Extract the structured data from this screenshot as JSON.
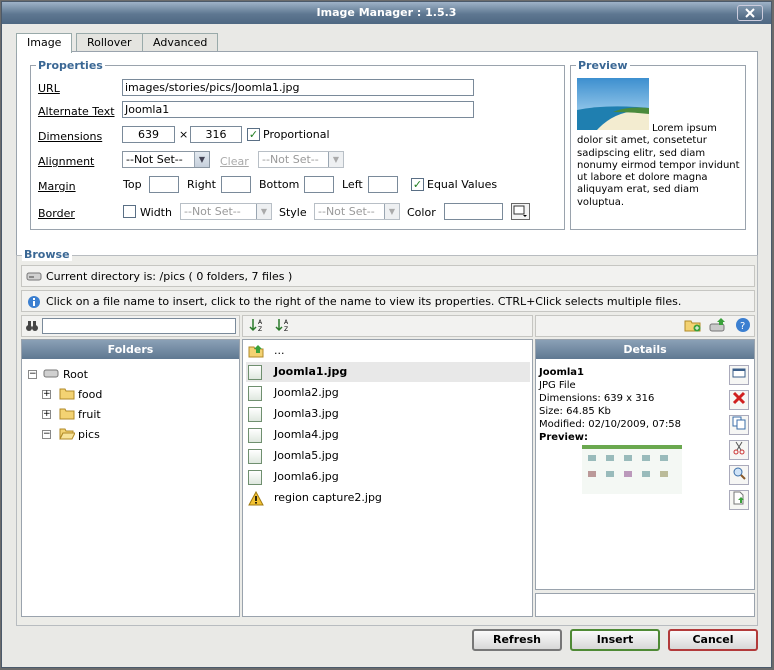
{
  "window": {
    "title": "Image Manager : 1.5.3"
  },
  "tabs": [
    "Image",
    "Rollover",
    "Advanced"
  ],
  "properties": {
    "legend": "Properties",
    "url_label": "URL",
    "url_value": "images/stories/pics/Joomla1.jpg",
    "alt_label": "Alternate Text",
    "alt_value": "Joomla1",
    "dimensions_label": "Dimensions",
    "width_value": "639",
    "times": "×",
    "height_value": "316",
    "proportional_label": "Proportional",
    "alignment_label": "Alignment",
    "alignment_value": "--Not Set--",
    "clear_label": "Clear",
    "clear_value": "--Not Set--",
    "margin_label": "Margin",
    "top_label": "Top",
    "right_label": "Right",
    "bottom_label": "Bottom",
    "left_label": "Left",
    "equal_values_label": "Equal Values",
    "border_label": "Border",
    "border_width_label": "Width",
    "border_width_value": "--Not Set--",
    "style_label": "Style",
    "style_value": "--Not Set--",
    "color_label": "Color"
  },
  "preview": {
    "legend": "Preview",
    "text": "Lorem ipsum dolor sit amet, consetetur sadipscing elitr, sed diam nonumy eirmod tempor invidunt ut labore et dolore magna aliquyam erat, sed diam voluptua."
  },
  "browse": {
    "legend": "Browse",
    "current_dir": "Current directory is: /pics ( 0 folders, 7 files )",
    "info": "Click on a file name to insert, click to the right of the name to view its properties. CTRL+Click selects multiple files.",
    "folders_header": "Folders",
    "details_header": "Details",
    "tree": {
      "root": "Root",
      "items": [
        "food",
        "fruit",
        "pics"
      ]
    },
    "up_label": "...",
    "files": [
      "Joomla1.jpg",
      "Joomla2.jpg",
      "Joomla3.jpg",
      "Joomla4.jpg",
      "Joomla5.jpg",
      "Joomla6.jpg",
      "region capture2.jpg"
    ],
    "details": {
      "name": "Joomla1",
      "type": "JPG File",
      "dimensions": "Dimensions: 639 x 316",
      "size": "Size: 64.85 Kb",
      "modified": "Modified: 02/10/2009, 07:58",
      "preview_label": "Preview:"
    }
  },
  "buttons": {
    "refresh": "Refresh",
    "insert": "Insert",
    "cancel": "Cancel"
  },
  "colors": {
    "title_bar": "#5e7791",
    "legend": "#3a6794",
    "cancel_border": "#b23a3a",
    "insert_border": "#4f8a35"
  }
}
